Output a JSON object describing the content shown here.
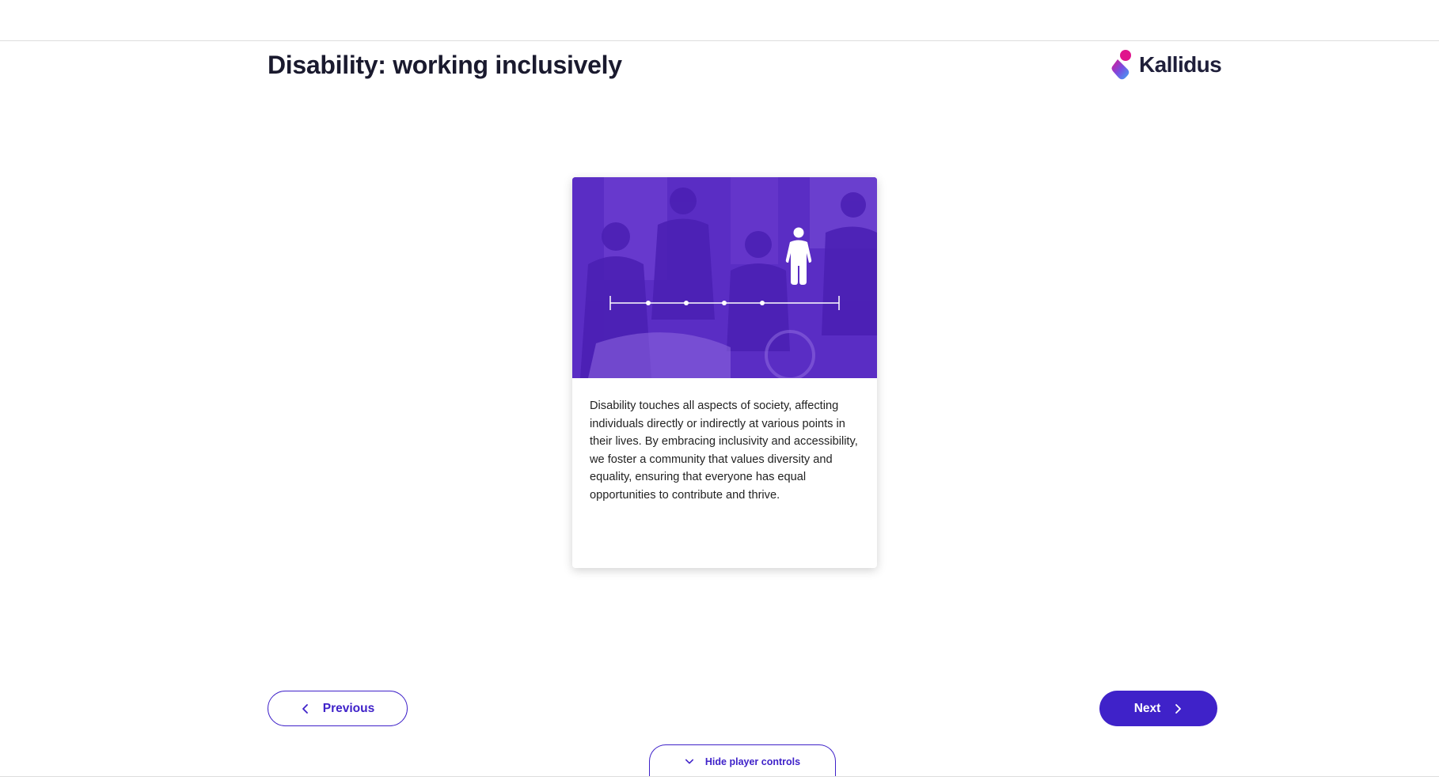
{
  "header": {
    "course_title": "Disability: working inclusively",
    "brand_name": "Kallidus"
  },
  "card": {
    "image_alt": "Group of students, one in a wheelchair, with a person icon above a timeline scale",
    "body_text": "Disability touches all aspects of society, affecting individuals directly or indirectly at various points in their lives. By embracing inclusivity and accessibility, we foster a community that values diversity and equality, ensuring that everyone has equal opportunities to contribute and thrive."
  },
  "navigation": {
    "previous_label": "Previous",
    "next_label": "Next",
    "hide_controls_label": "Hide player controls"
  },
  "colors": {
    "accent": "#3f22c9",
    "image_overlay": "#5a2dc4",
    "brand_pink": "#e0148c",
    "brand_blue": "#3fa9f5"
  },
  "icons": {
    "previous": "chevron-left-icon",
    "next": "chevron-right-icon",
    "hide_controls": "chevron-down-icon",
    "figure": "person-icon"
  }
}
